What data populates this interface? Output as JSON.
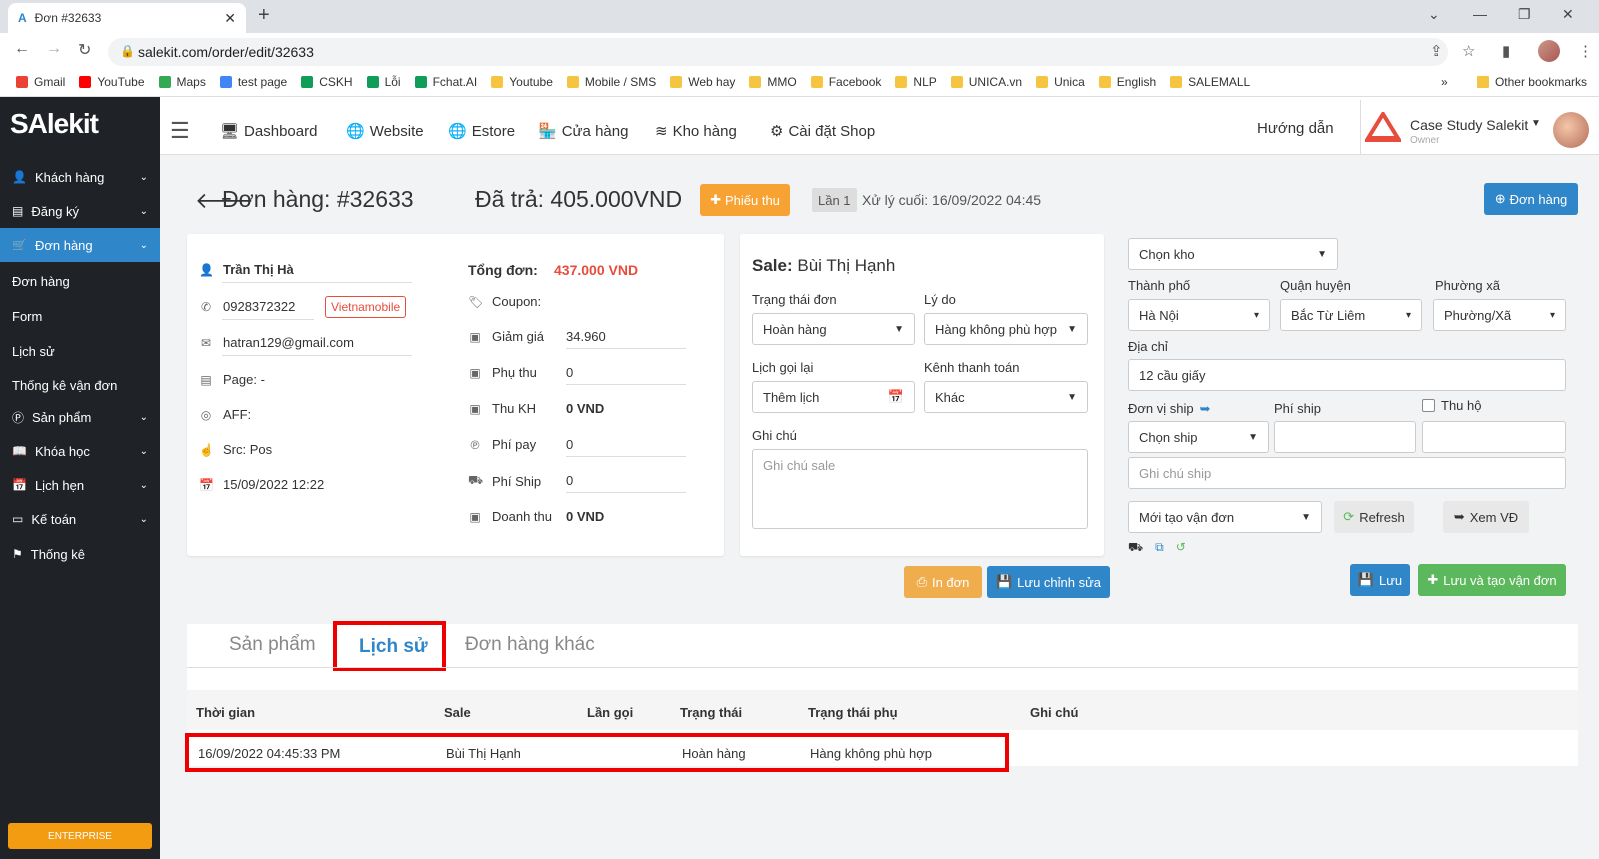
{
  "browser": {
    "tab_title": "Đơn #32633",
    "url": "salekit.com/order/edit/32633",
    "bookmarks": [
      {
        "label": "Gmail",
        "color": "#ea4335"
      },
      {
        "label": "YouTube",
        "color": "#ff0000"
      },
      {
        "label": "Maps",
        "color": "#34a853"
      },
      {
        "label": "test page",
        "color": "#4285f4"
      },
      {
        "label": "CSKH",
        "color": "#0f9d58"
      },
      {
        "label": "Lỗi",
        "color": "#0f9d58"
      },
      {
        "label": "Fchat.AI",
        "color": "#0f9d58"
      },
      {
        "label": "Youtube",
        "color": "#f5c542"
      },
      {
        "label": "Mobile / SMS",
        "color": "#f5c542"
      },
      {
        "label": "Web hay",
        "color": "#f5c542"
      },
      {
        "label": "MMO",
        "color": "#f5c542"
      },
      {
        "label": "Facebook",
        "color": "#f5c542"
      },
      {
        "label": "NLP",
        "color": "#f5c542"
      },
      {
        "label": "UNICA.vn",
        "color": "#f5c542"
      },
      {
        "label": "Unica",
        "color": "#f5c542"
      },
      {
        "label": "English",
        "color": "#f5c542"
      },
      {
        "label": "SALEMALL",
        "color": "#f5c542"
      }
    ],
    "more": "»",
    "other_bookmarks": "Other bookmarks"
  },
  "sidebar": {
    "logo": "SAlekit",
    "items": [
      {
        "label": "Khách hàng",
        "icon": "user-icon"
      },
      {
        "label": "Đăng ký",
        "icon": "card-icon"
      },
      {
        "label": "Đơn hàng",
        "icon": "cart-icon"
      },
      {
        "label": "Sản phẩm",
        "icon": "product-icon"
      },
      {
        "label": "Khóa học",
        "icon": "book-icon"
      },
      {
        "label": "Lịch hẹn",
        "icon": "calendar-icon"
      },
      {
        "label": "Kế toán",
        "icon": "credit-card-icon"
      },
      {
        "label": "Thống kê",
        "icon": "flag-icon"
      }
    ],
    "subitems": [
      "Đơn hàng",
      "Form",
      "Lịch sử",
      "Thống kê vận đơn"
    ],
    "enterprise": "ENTERPRISE"
  },
  "topnav": {
    "items": [
      "Dashboard",
      "Website",
      "Estore",
      "Cửa hàng",
      "Kho hàng",
      "Cài đặt Shop"
    ],
    "help": "Hướng dẫn",
    "shop_name": "Case Study Salekit",
    "shop_role": "Owner"
  },
  "header": {
    "title": "Đơn hàng: #32633",
    "paid": "Đã trả: 405.000VND",
    "receipt_button": "Phiếu thu",
    "attempt": "Lần 1",
    "last_processed": "Xử lý cuối: 16/09/2022 04:45",
    "new_order_button": "Đơn hàng"
  },
  "customer": {
    "name": "Trần Thị Hà",
    "phone": "0928372322",
    "carrier": "Vietnamobile",
    "email": "hatran129@gmail.com",
    "page": "Page: -",
    "aff": "AFF:",
    "src": "Src: Pos",
    "date": "15/09/2022 12:22"
  },
  "totals": {
    "total_label": "Tổng đơn:",
    "total_value": "437.000 VND",
    "coupon_label": "Coupon:",
    "discount_label": "Giảm giá",
    "discount_value": "34.960",
    "surcharge_label": "Phụ thu",
    "surcharge_value": "0",
    "paid_label": "Thu KH",
    "paid_value": "0 VND",
    "payfee_label": "Phí pay",
    "payfee_value": "0",
    "shipfee_label": "Phí Ship",
    "shipfee_value": "0",
    "revenue_label": "Doanh thu",
    "revenue_value": "0 VND"
  },
  "sale": {
    "label": "Sale:",
    "name": "Bùi Thị Hạnh",
    "status_label": "Trạng thái đơn",
    "status_value": "Hoàn hàng",
    "reason_label": "Lý do",
    "reason_value": "Hàng không phù hợp",
    "callback_label": "Lịch gọi lại",
    "callback_value": "Thêm lịch",
    "payment_label": "Kênh thanh toán",
    "payment_value": "Khác",
    "note_label": "Ghi chú",
    "note_placeholder": "Ghi chú sale"
  },
  "shipping": {
    "warehouse": "Chọn kho",
    "city_label": "Thành phố",
    "city": "Hà Nội",
    "district_label": "Quận huyện",
    "district": "Bắc Từ Liêm",
    "ward_label": "Phường xã",
    "ward": "Phường/Xã",
    "address_label": "Địa chỉ",
    "address": "12 cầu giấy",
    "carrier_label": "Đơn vị ship",
    "fee_label": "Phí ship",
    "cod_label": "Thu hộ",
    "carrier": "Chọn ship",
    "ship_note_placeholder": "Ghi chú ship",
    "waybill_status": "Mới tạo vận đơn",
    "refresh": "Refresh",
    "view_waybill": "Xem VĐ",
    "save": "Lưu",
    "save_create": "Lưu và tạo vận đơn"
  },
  "actions": {
    "print": "In đơn",
    "save_edit": "Lưu chỉnh sửa"
  },
  "tabs": [
    "Sản phẩm",
    "Lịch sử",
    "Đơn hàng khác"
  ],
  "history": {
    "headers": [
      "Thời gian",
      "Sale",
      "Lần gọi",
      "Trạng thái",
      "Trạng thái phụ",
      "Ghi chú"
    ],
    "rows": [
      [
        "16/09/2022 04:45:33 PM",
        "Bùi Thị Hạnh",
        "",
        "Hoàn hàng",
        "Hàng không phù hợp",
        ""
      ]
    ]
  },
  "colors": {
    "primary": "#2f86c9",
    "warning": "#f7a334",
    "success": "#5cb85c",
    "danger": "#e74c3c",
    "sidebar": "#1f2328",
    "highlight": "#e00000"
  }
}
